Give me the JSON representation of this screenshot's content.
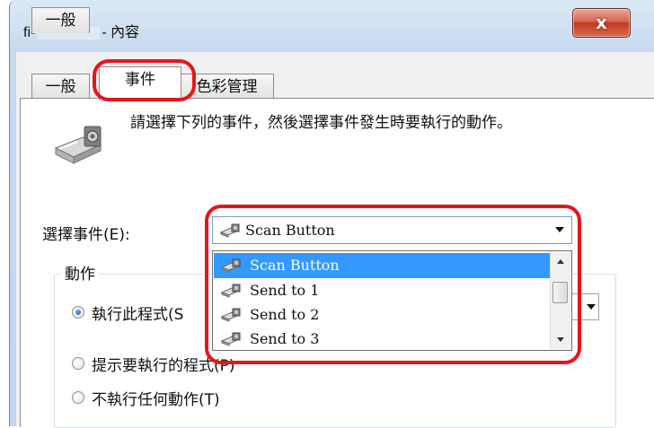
{
  "window": {
    "title_prefix": "fi-",
    "title_suffix": "- 內容",
    "close_glyph": "x"
  },
  "tabs": [
    {
      "label": "一般",
      "active": false
    },
    {
      "label": "事件",
      "active": true
    },
    {
      "label": "色彩管理",
      "active": false
    }
  ],
  "events_tab": {
    "description": "請選擇下列的事件，然後選擇事件發生時要執行的動作。",
    "select_event_label": "選擇事件(E):",
    "combo_selected": "Scan Button",
    "options": [
      "Scan Button",
      "Send to 1",
      "Send to 2",
      "Send to 3"
    ],
    "highlighted_option_index": 0,
    "actions_legend": "動作",
    "radio_run_program": "執行此程式(S",
    "radio_prompt": "提示要執行的程式(P)",
    "radio_no_action": "不執行任何動作(T)",
    "selected_radio": "run_program"
  },
  "colors": {
    "highlight_frame": "#e8141b",
    "selection": "#3399ff",
    "close_button": "#c13a22"
  },
  "icons": [
    "scanner-icon",
    "scanner-mini-icon",
    "close-icon"
  ]
}
